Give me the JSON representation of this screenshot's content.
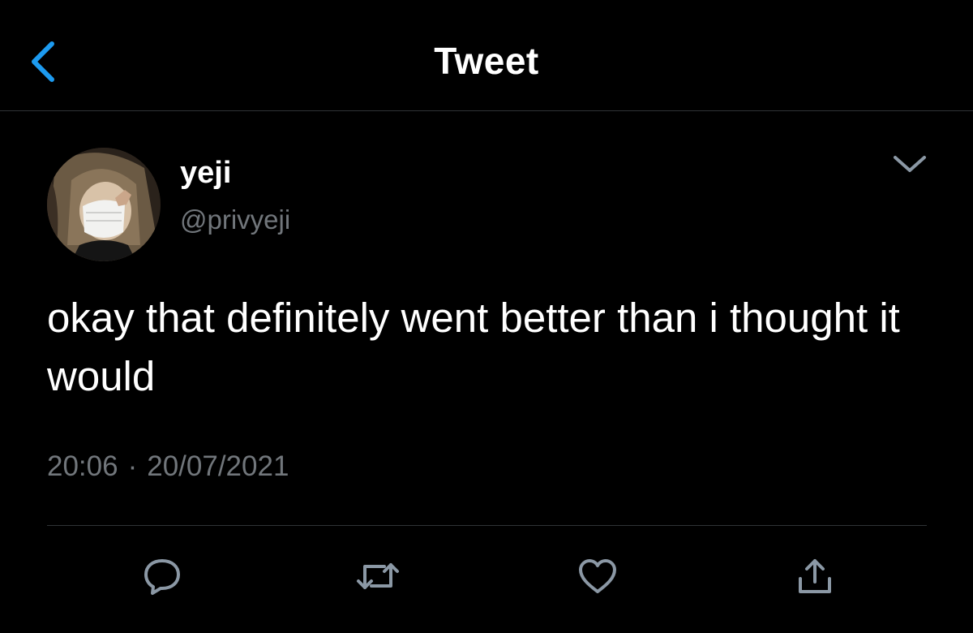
{
  "header": {
    "title": "Tweet",
    "back_icon": "chevron-left-icon",
    "accent_color": "#1d9bf0"
  },
  "tweet": {
    "author": {
      "name": "yeji",
      "handle": "@privyeji"
    },
    "text": "okay that definitely went better than i thought it would",
    "time": "20:06",
    "separator": "·",
    "date": "20/07/2021"
  },
  "actions": [
    {
      "name": "reply",
      "icon": "reply-icon"
    },
    {
      "name": "retweet",
      "icon": "retweet-icon"
    },
    {
      "name": "like",
      "icon": "heart-icon"
    },
    {
      "name": "share",
      "icon": "share-icon"
    }
  ],
  "colors": {
    "background": "#000000",
    "text": "#ffffff",
    "secondary_text": "#71767b",
    "icon": "#8b98a5",
    "divider": "#2f3336"
  }
}
